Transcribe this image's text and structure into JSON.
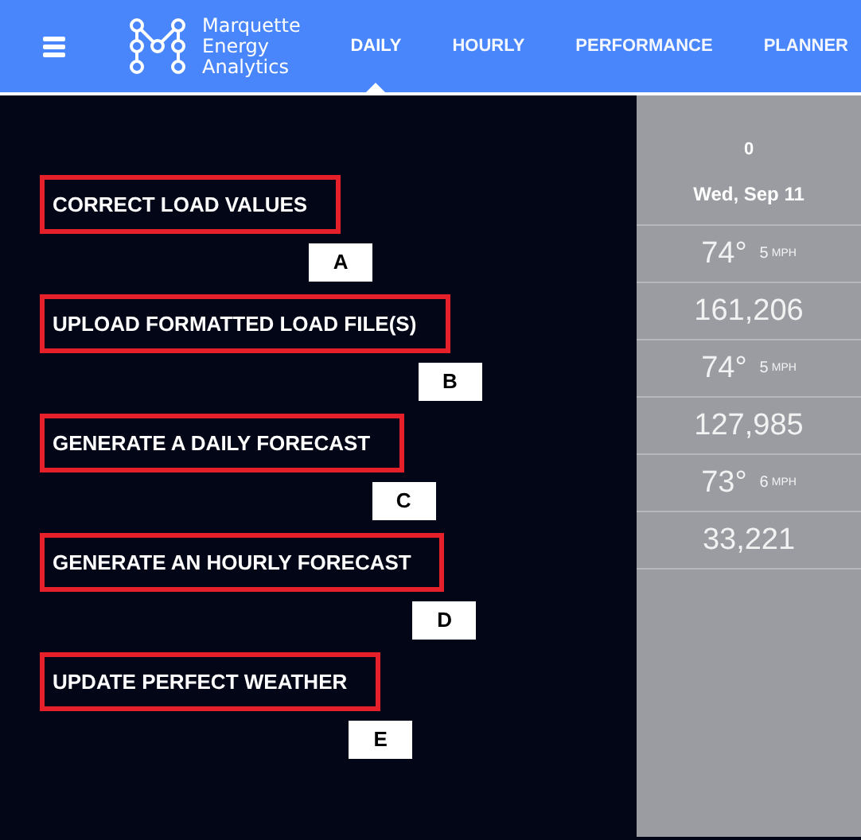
{
  "header": {
    "brand": [
      "Marquette",
      "Energy",
      "Analytics"
    ],
    "tabs": [
      {
        "label": "DAILY",
        "selected": true
      },
      {
        "label": "HOURLY",
        "selected": false
      },
      {
        "label": "PERFORMANCE",
        "selected": false
      },
      {
        "label": "PLANNER",
        "selected": false
      }
    ]
  },
  "actions": [
    {
      "label": "CORRECT LOAD VALUES",
      "badge": "A"
    },
    {
      "label": "UPLOAD FORMATTED LOAD FILE(S)",
      "badge": "B"
    },
    {
      "label": "GENERATE A DAILY FORECAST",
      "badge": "C"
    },
    {
      "label": "GENERATE AN HOURLY FORECAST",
      "badge": "D"
    },
    {
      "label": "UPDATE PERFECT WEATHER",
      "badge": "E"
    }
  ],
  "day_column": {
    "index": "0",
    "date": "Wed, Sep 11",
    "rows": [
      {
        "kind": "weather",
        "temp": "74°",
        "wind": "5",
        "unit": "MPH"
      },
      {
        "kind": "load",
        "value": "161,206"
      },
      {
        "kind": "weather",
        "temp": "74°",
        "wind": "5",
        "unit": "MPH"
      },
      {
        "kind": "load",
        "value": "127,985"
      },
      {
        "kind": "weather",
        "temp": "73°",
        "wind": "6",
        "unit": "MPH"
      },
      {
        "kind": "load",
        "value": "33,221"
      }
    ]
  }
}
